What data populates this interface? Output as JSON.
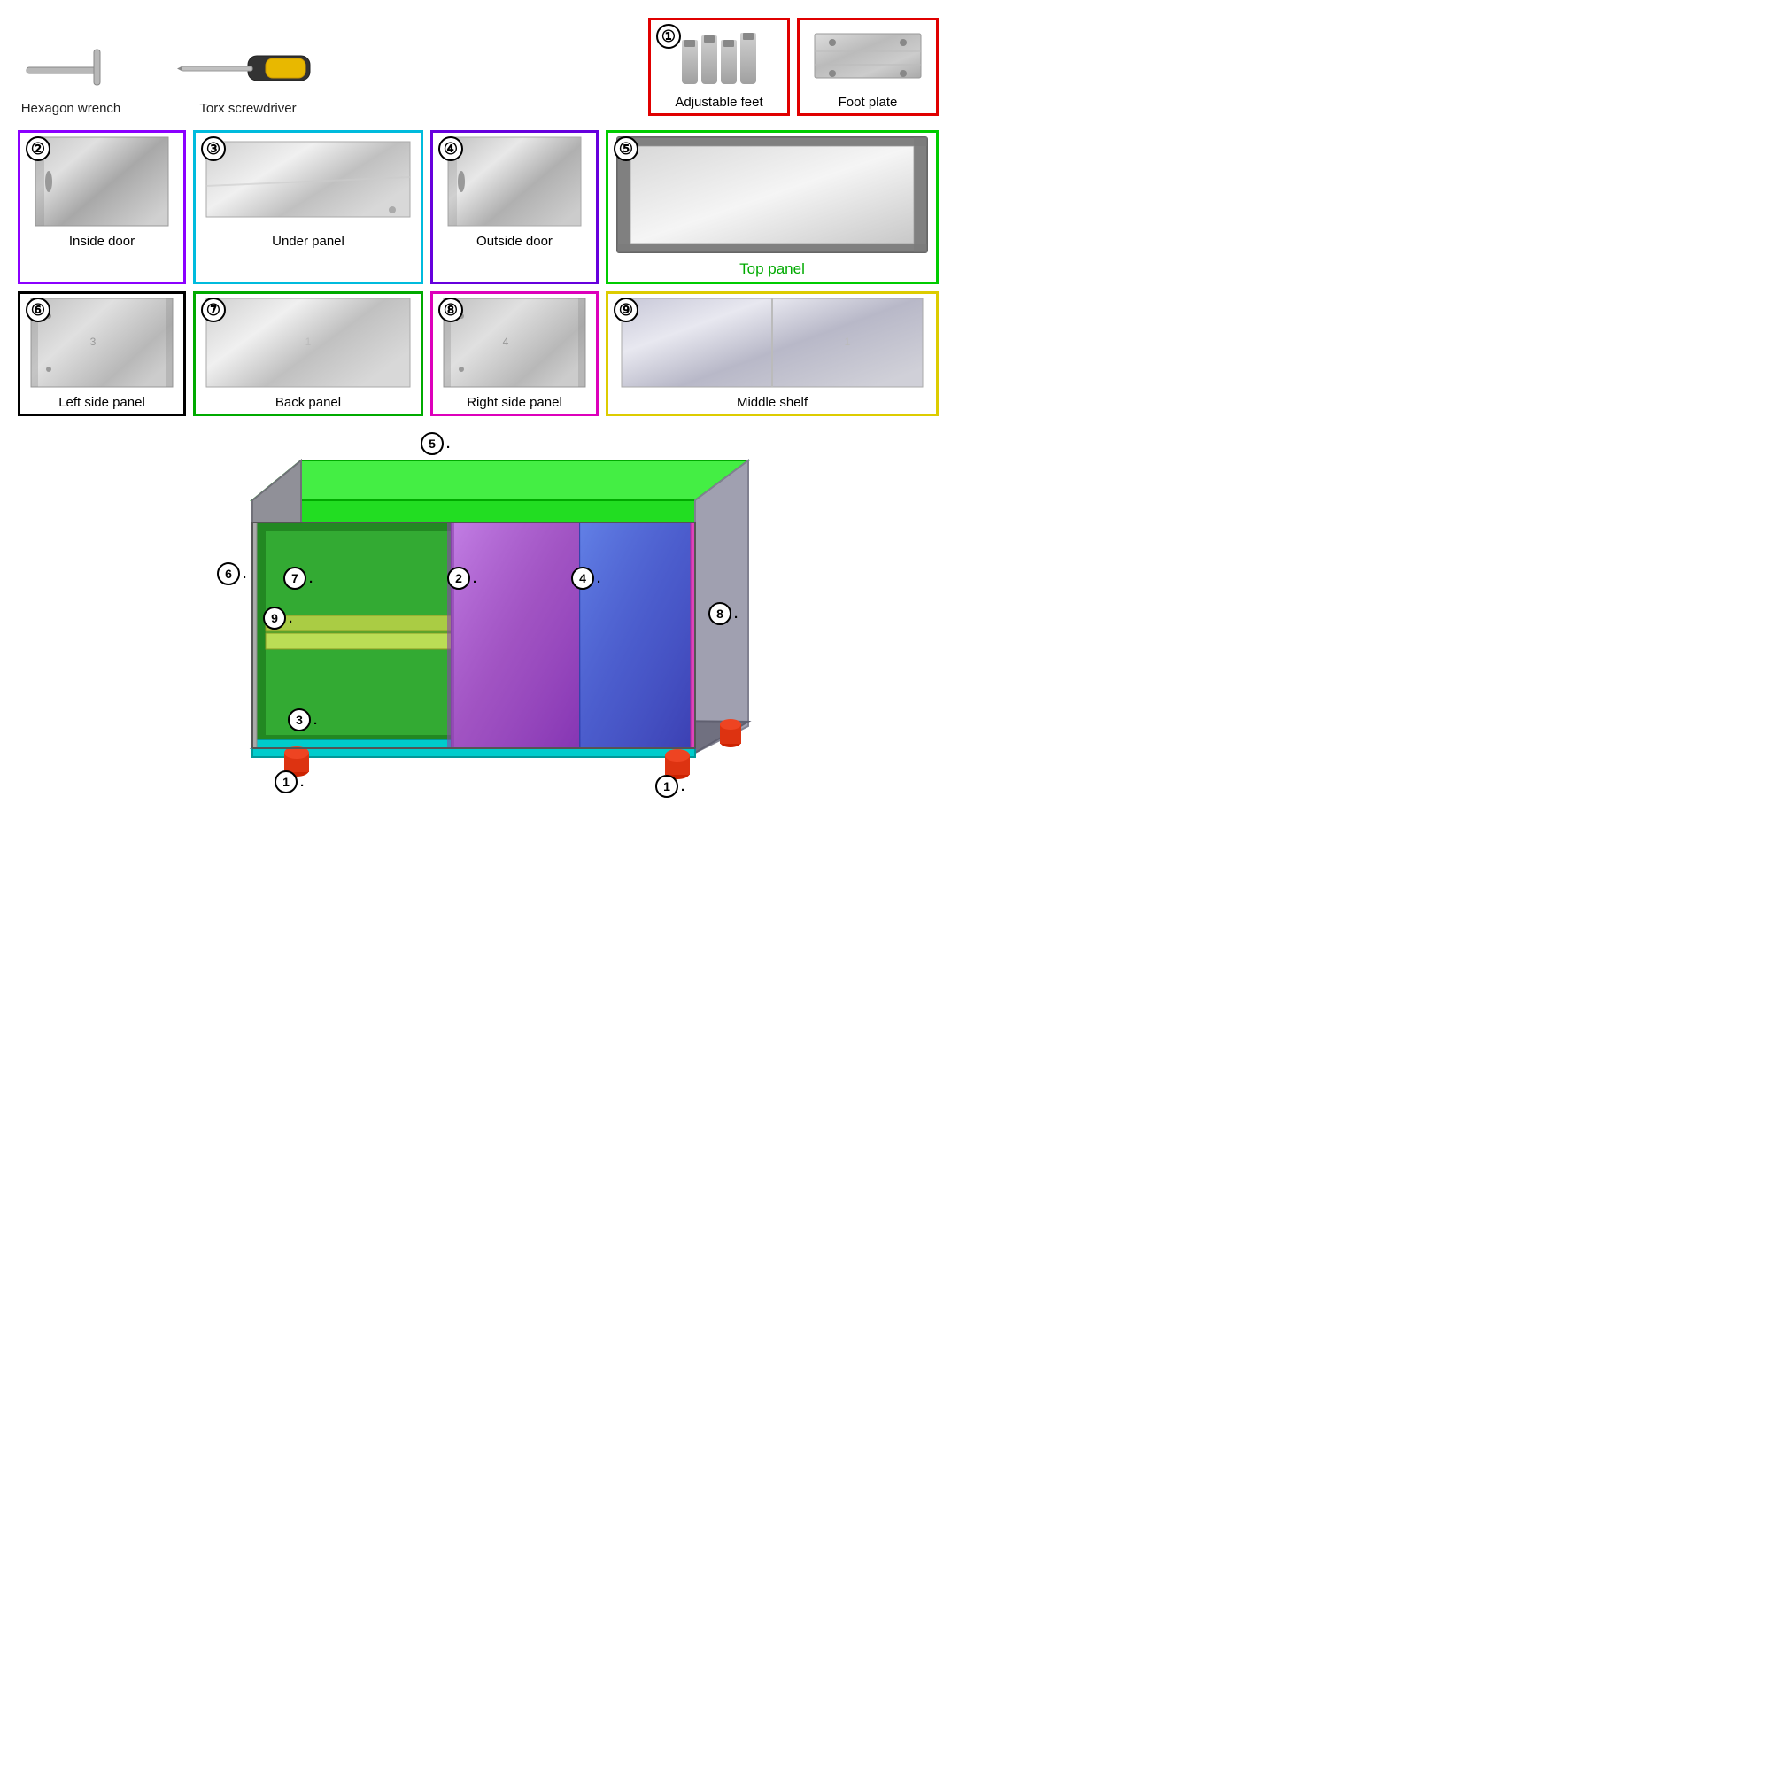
{
  "tools": [
    {
      "id": "hexagon-wrench",
      "label": "Hexagon wrench",
      "type": "wrench"
    },
    {
      "id": "torx-screwdriver",
      "label": "Torx screwdriver",
      "type": "screwdriver"
    }
  ],
  "parts": [
    {
      "number": "1",
      "label": "Adjustable feet",
      "border_color": "#e00000",
      "type": "adjustable-feet"
    },
    {
      "number": "",
      "label": "Foot plate",
      "border_color": "#e00000",
      "type": "foot-plate"
    },
    {
      "number": "2",
      "label": "Inside door",
      "border_color": "#8b00ff",
      "type": "panel-door"
    },
    {
      "number": "3",
      "label": "Under panel",
      "border_color": "#00bbdd",
      "type": "panel-wide"
    },
    {
      "number": "4",
      "label": "Outside door",
      "border_color": "#6600dd",
      "type": "panel-door"
    },
    {
      "number": "5",
      "label": "Top panel",
      "border_color": "#00cc00",
      "type": "panel-top"
    },
    {
      "number": "6",
      "label": "Left side panel",
      "border_color": "#000000",
      "type": "panel-side"
    },
    {
      "number": "7",
      "label": "Back panel",
      "border_color": "#00aa00",
      "type": "panel-wide"
    },
    {
      "number": "8",
      "label": "Right side panel",
      "border_color": "#dd00bb",
      "type": "panel-side"
    },
    {
      "number": "9",
      "label": "Middle shelf",
      "border_color": "#ddcc00",
      "type": "panel-shelf"
    }
  ],
  "diagram": {
    "labels": {
      "top": "5.",
      "left_side": "6.",
      "back": "7.",
      "inside_door_left": "2.",
      "outside_door_right": "4.",
      "right_side": "8.",
      "shelf": "9.",
      "under_panel": "3.",
      "feet": "1."
    }
  }
}
